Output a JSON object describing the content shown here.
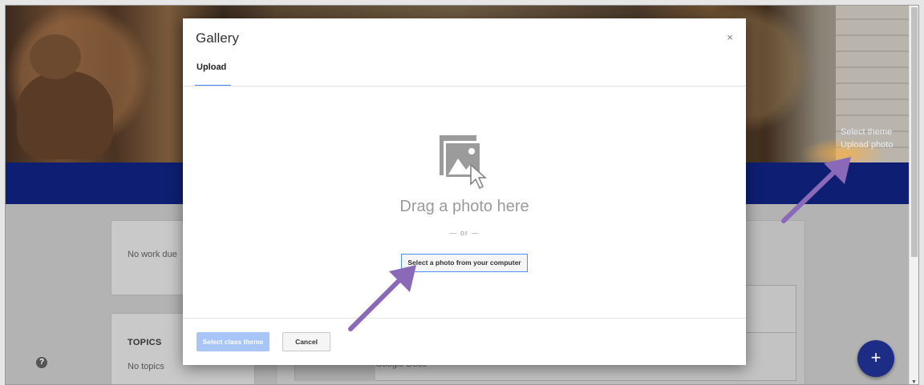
{
  "background": {
    "theme_links": {
      "select_theme": "Select theme",
      "upload_photo": "Upload photo"
    },
    "upcoming": {
      "empty_text": "No work due"
    },
    "topics": {
      "title": "TOPICS",
      "empty_text": "No topics"
    },
    "stream": {
      "item_label": "Google Docs"
    },
    "help_icon": "?",
    "fab_icon": "+"
  },
  "dialog": {
    "title": "Gallery",
    "close_glyph": "×",
    "tabs": [
      {
        "label": "Upload",
        "active": true
      }
    ],
    "dropzone": {
      "drag_text": "Drag a photo here",
      "or_text": "— or —",
      "select_button": "Select a photo from your computer"
    },
    "footer": {
      "primary_button": "Select class theme",
      "cancel_button": "Cancel"
    }
  },
  "colors": {
    "accent_blue": "#4285f4",
    "navy_band": "#0e1f73",
    "annotation_arrow": "#8a69b8",
    "disabled_primary": "#a8c5f8"
  },
  "icons": [
    "image-icon",
    "close-icon",
    "help-icon",
    "plus-icon",
    "annotation-arrow"
  ]
}
